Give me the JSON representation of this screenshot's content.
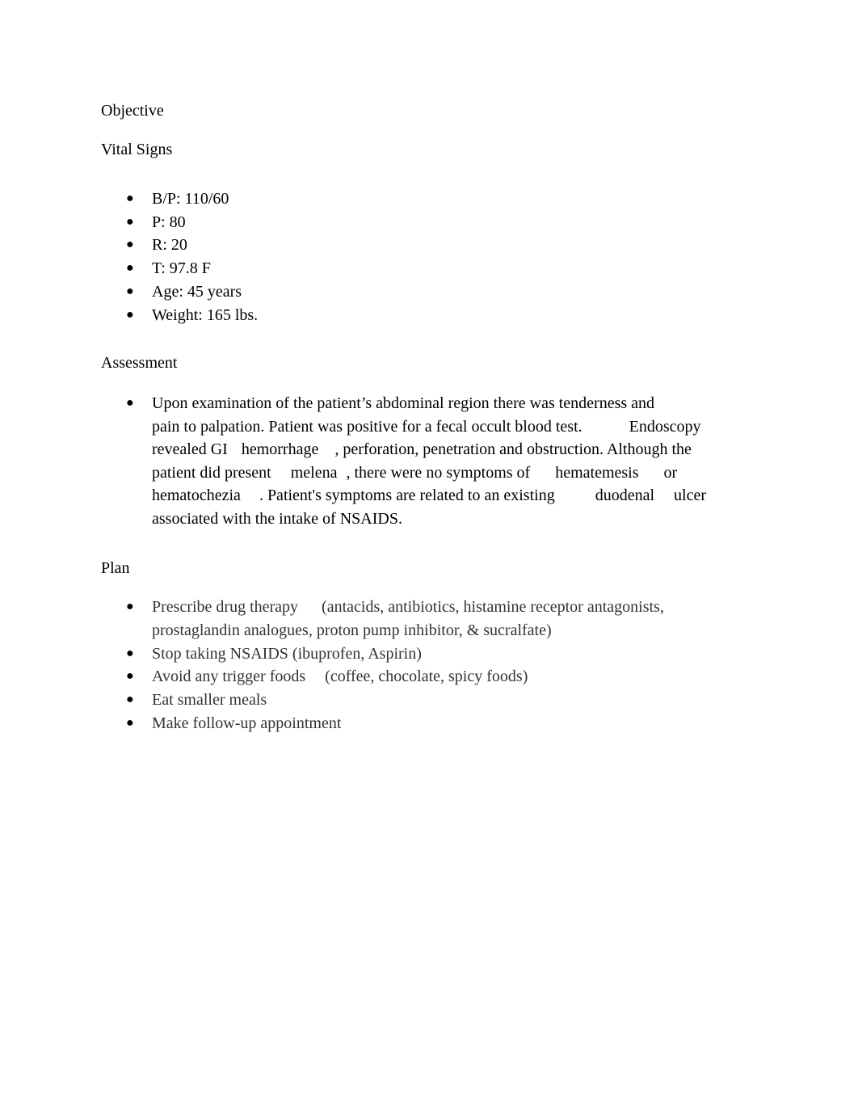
{
  "document": {
    "objective_heading": "Objective",
    "vital_signs_heading": "Vital Signs",
    "vital_signs": [
      "B/P: 110/60",
      "P: 80",
      "R: 20",
      "T: 97.8 F",
      "Age: 45 years",
      "Weight: 165 lbs."
    ],
    "assessment_heading": "Assessment",
    "assessment_lines": [
      "Upon examination of the patient’s abdominal region there was tenderness and",
      "pain to palpation. Patient was positive for a fecal occult blood test.",
      "Endoscopy",
      "revealed GI",
      "hemorrhage",
      ", perforation, penetration and obstruction. Although the",
      "patient did present",
      "melena",
      ", there were no symptoms of",
      "hematemesis",
      "or",
      "hematochezia",
      ". Patient's symptoms are related to an existing",
      "duodenal",
      "ulcer",
      "associated with the intake of NSAIDS."
    ],
    "plan_heading": "Plan",
    "plan_items": [
      {
        "line1a": "Prescribe drug therapy",
        "line1b": "(antacids, antibiotics, histamine receptor antagonists,",
        "line2": "prostaglandin analogues, proton pump inhibitor, & sucralfate)"
      },
      {
        "text": "Stop taking NSAIDS (ibuprofen, Aspirin)"
      },
      {
        "line1a": "Avoid any trigger foods",
        "line1b": "(coffee, chocolate, spicy foods)"
      },
      {
        "text": "Eat smaller meals"
      },
      {
        "text": "Make follow-up appointment"
      }
    ],
    "bullet_glyph": "●"
  }
}
